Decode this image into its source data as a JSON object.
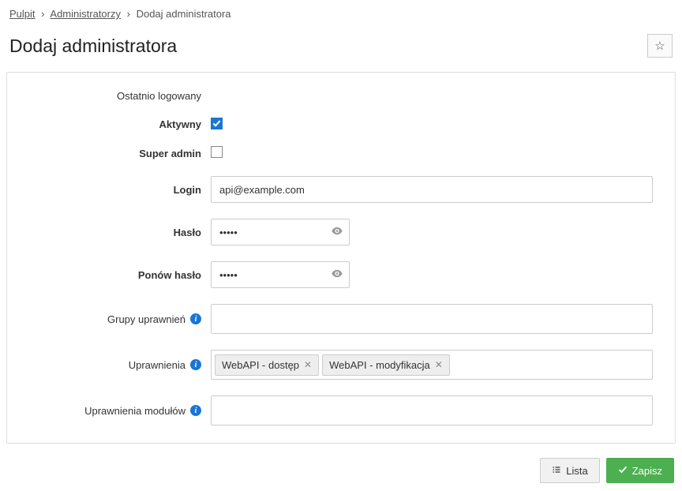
{
  "breadcrumb": {
    "items": [
      "Pulpit",
      "Administratorzy",
      "Dodaj administratora"
    ]
  },
  "page_title": "Dodaj administratora",
  "form": {
    "last_login_label": "Ostatnio logowany",
    "active_label": "Aktywny",
    "active_checked": true,
    "superadmin_label": "Super admin",
    "superadmin_checked": false,
    "login_label": "Login",
    "login_value": "api@example.com",
    "password_label": "Hasło",
    "password_value": "•••••",
    "password_repeat_label": "Ponów hasło",
    "password_repeat_value": "•••••",
    "permission_groups_label": "Grupy uprawnień",
    "permissions_label": "Uprawnienia",
    "permission_tags": [
      "WebAPI - dostęp",
      "WebAPI - modyfikacja"
    ],
    "module_permissions_label": "Uprawnienia modułów"
  },
  "buttons": {
    "list": "Lista",
    "save": "Zapisz"
  }
}
